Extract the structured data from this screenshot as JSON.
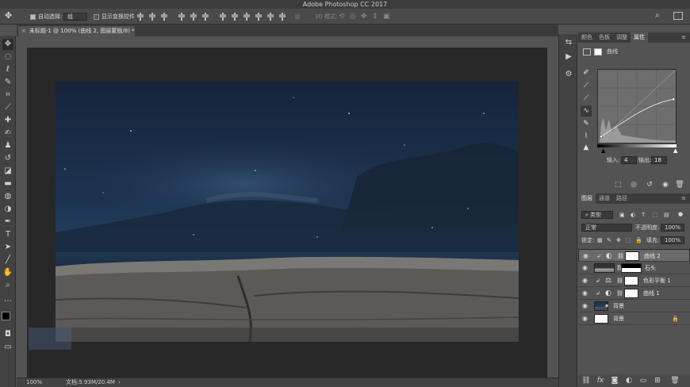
{
  "app": {
    "title": "Adobe Photoshop CC 2017"
  },
  "options": {
    "auto_select_label": "自动选择:",
    "auto_select_value": "组",
    "show_transform_label": "显示变换控件",
    "mode_3d_label": "3D 模式:"
  },
  "document": {
    "tab_title": "未标题-1 @ 100% (曲线 2, 图层蒙版/8) *"
  },
  "status": {
    "zoom": "100%",
    "doc_size": "文档:5.93M/20.4M"
  },
  "properties_panel": {
    "tabs": [
      "颜色",
      "色板",
      "调整",
      "属性"
    ],
    "active_tab": "属性",
    "adjustment_name": "曲线",
    "input_label": "输入:",
    "input_value": "4",
    "output_label": "输出:",
    "output_value": "18"
  },
  "layers_panel": {
    "tabs": [
      "图层",
      "通道",
      "路径"
    ],
    "filter_label": "类型",
    "blend_mode": "正常",
    "opacity_label": "不透明度:",
    "opacity_value": "100%",
    "lock_label": "锁定:",
    "fill_label": "填充:",
    "fill_value": "100%",
    "layers": [
      {
        "name": "曲线 2",
        "type": "curves",
        "selected": true
      },
      {
        "name": "石头",
        "type": "image",
        "selected": false
      },
      {
        "name": "色彩平衡 1",
        "type": "balance",
        "selected": false
      },
      {
        "name": "曲线 1",
        "type": "curves",
        "selected": false
      },
      {
        "name": "背景",
        "type": "image",
        "selected": false
      },
      {
        "name": "背景",
        "type": "background",
        "selected": false
      }
    ]
  },
  "colors": {
    "sky_top": "#16243a",
    "rock": "#5b5a58"
  }
}
